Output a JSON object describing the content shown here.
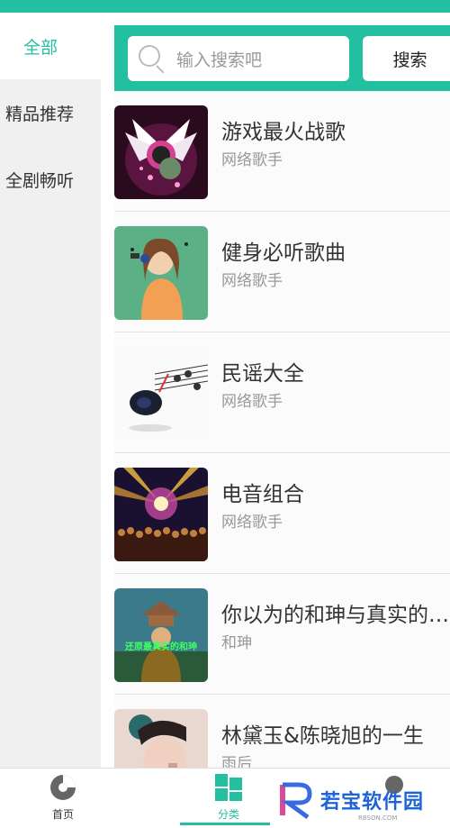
{
  "sidebar": {
    "items": [
      {
        "label": "全部",
        "active": true
      },
      {
        "label": "精品推荐",
        "active": false
      },
      {
        "label": "全剧畅听",
        "active": false
      }
    ]
  },
  "search": {
    "placeholder": "输入搜索吧",
    "button_label": "搜索"
  },
  "list": {
    "items": [
      {
        "title": "游戏最火战歌",
        "artist": "网络歌手",
        "cover": "winged-headphones-art"
      },
      {
        "title": "健身必听歌曲",
        "artist": "网络歌手",
        "cover": "girl-with-headphones-art"
      },
      {
        "title": "民谣大全",
        "artist": "网络歌手",
        "cover": "music-notes-art"
      },
      {
        "title": "电音组合",
        "artist": "网络歌手",
        "cover": "concert-crowd-photo"
      },
      {
        "title": "你以为的和珅与真实的…",
        "artist": "和珅",
        "cover": "heshen-poster"
      },
      {
        "title": "林黛玉&陈晓旭的一生",
        "artist": "雨后",
        "cover": "woman-portrait"
      }
    ]
  },
  "cover_text": {
    "heshen": "还原最真实的和珅"
  },
  "bottom_nav": {
    "items": [
      {
        "label": "首页",
        "icon": "disc-icon"
      },
      {
        "label": "分类",
        "icon": "grid-icon",
        "active": true
      },
      {
        "label": "",
        "icon": "user-icon"
      }
    ]
  },
  "watermark": {
    "text": "若宝软件园",
    "sub": "RBSON.COM"
  },
  "colors": {
    "accent": "#22bfa0",
    "watermark": "#1e63d8"
  }
}
